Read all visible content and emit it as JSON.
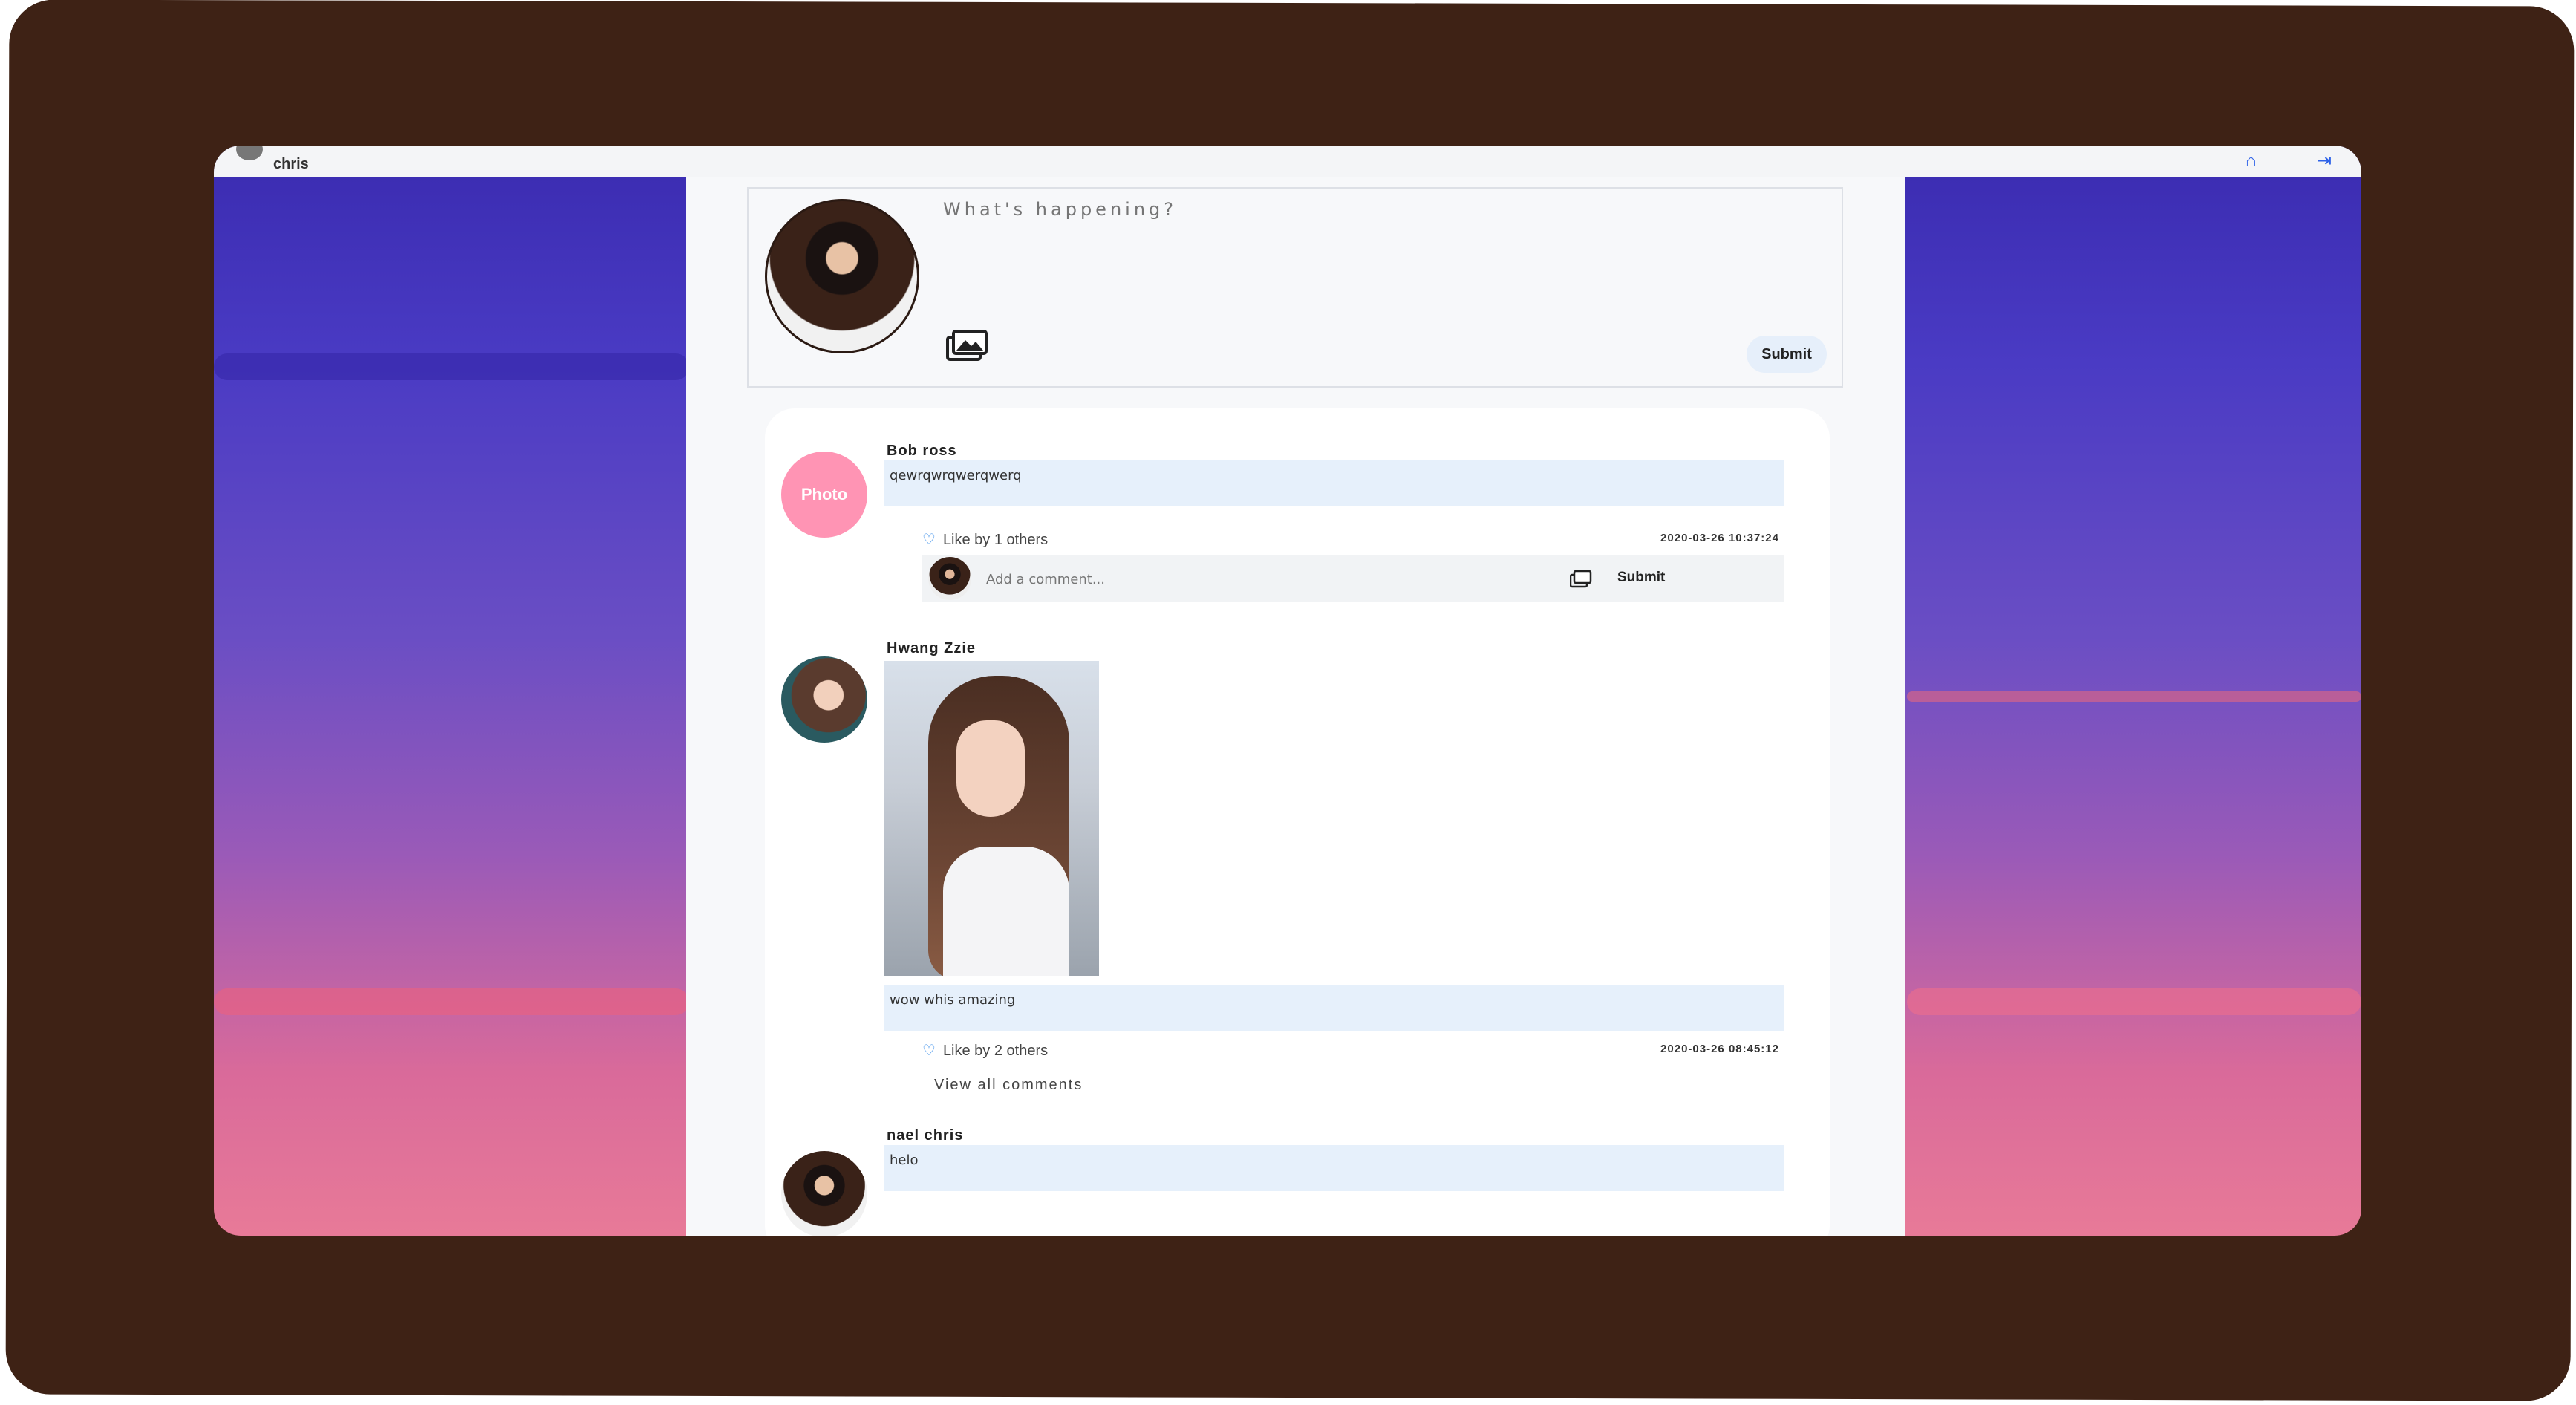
{
  "header": {
    "user_name": "chris",
    "home_icon": "home-icon",
    "logout_icon": "logout-icon"
  },
  "composer": {
    "placeholder": "What's happening?",
    "submit_label": "Submit",
    "image_icon": "image-upload-icon"
  },
  "posts": [
    {
      "author": "Bob ross",
      "avatar_text": "Photo",
      "text": "qewrqwrqwerqwerq",
      "likes": "Like by 1 others",
      "time": "2020-03-26 10:37:24",
      "comment_placeholder": "Add a comment...",
      "comment_submit": "Submit"
    },
    {
      "author": "Hwang Zzie",
      "text": "wow whis amazing",
      "likes": "Like by 2 others",
      "time": "2020-03-26 08:45:12",
      "view_all": "View all comments"
    },
    {
      "author": "nael chris",
      "text": "helo"
    }
  ],
  "colors": {
    "frame": "#3e2215",
    "accent": "#2e62e8",
    "bubble": "#e6f0fb",
    "photo_avatar": "#ff94b4"
  }
}
